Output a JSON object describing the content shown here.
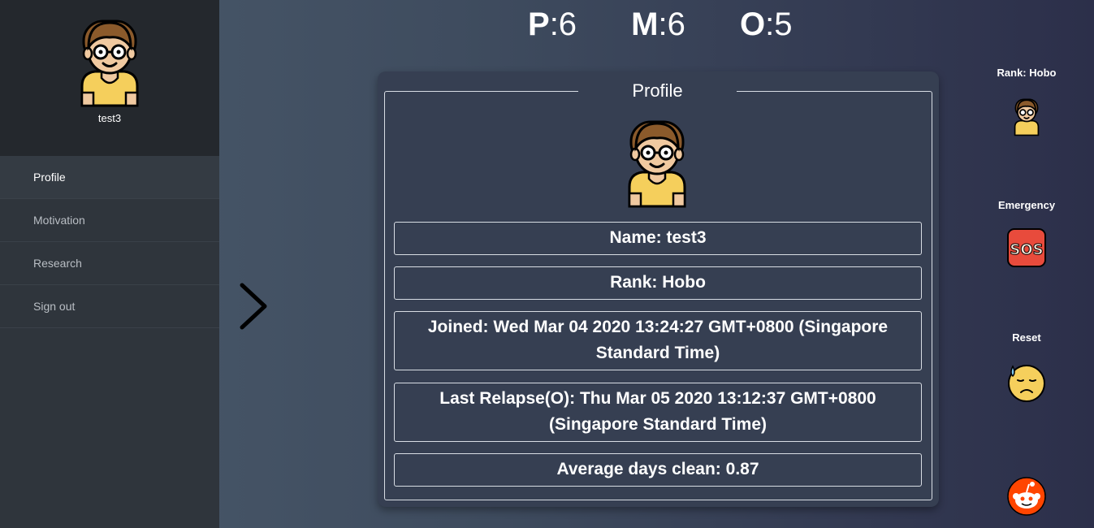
{
  "sidebar": {
    "username": "test3",
    "items": [
      {
        "label": "Profile"
      },
      {
        "label": "Motivation"
      },
      {
        "label": "Research"
      },
      {
        "label": "Sign out"
      }
    ]
  },
  "stats": {
    "p_key": "P",
    "p_val": ":6",
    "m_key": "M",
    "m_val": ":6",
    "o_key": "O",
    "o_val": ":5"
  },
  "profile": {
    "title": "Profile",
    "name": "Name: test3",
    "rank": "Rank: Hobo",
    "joined": "Joined: Wed Mar 04 2020 13:24:27 GMT+0800 (Singapore Standard Time)",
    "last_relapse": "Last Relapse(O): Thu Mar 05 2020 13:12:37 GMT+0800 (Singapore Standard Time)",
    "average": "Average days clean: 0.87"
  },
  "right_panel": {
    "rank_label": "Rank: Hobo",
    "emergency_label": "Emergency",
    "sos_text": "SOS",
    "reset_label": "Reset"
  }
}
